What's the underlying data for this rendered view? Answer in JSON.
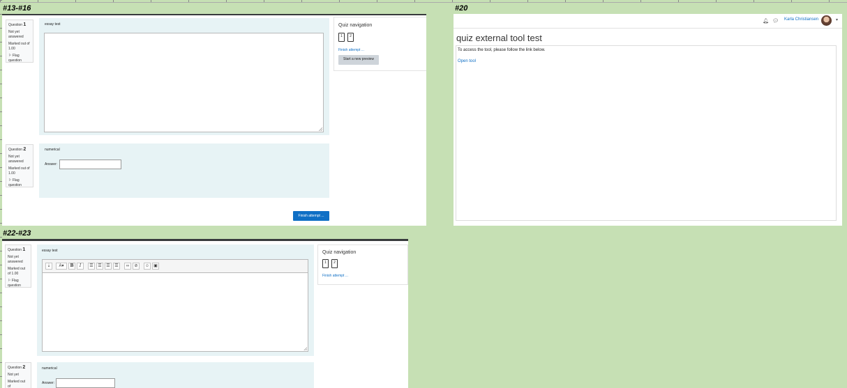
{
  "labels": {
    "p1": "#13-#16",
    "p2": "#20",
    "p3": "#22-#23"
  },
  "panel1": {
    "q1": {
      "label": "Question",
      "number": "1",
      "status": "Not yet answered",
      "mark": "Marked out of 1.00",
      "flag": "Flag question",
      "text": "essay test"
    },
    "q2": {
      "label": "Question",
      "number": "2",
      "status": "Not yet answered",
      "mark": "Marked out of 1.00",
      "flag": "Flag question",
      "text": "numerical",
      "answer_label": "Answer:"
    },
    "nav": {
      "title": "Quiz navigation",
      "buttons": [
        "1",
        "2"
      ],
      "finish_link": "Finish attempt ...",
      "preview_button": "Start a new preview"
    },
    "finish_button": "Finish attempt ..."
  },
  "panel2": {
    "user": "Karla Christiansen",
    "title": "quiz external tool test",
    "description": "To access the tool, please follow the link below.",
    "link": "Open tool",
    "colors": {
      "link": "#0f6fc5"
    }
  },
  "panel3": {
    "q1": {
      "label": "Question",
      "number": "1",
      "status": "Not yet answered",
      "mark": "Marked out of 1.00",
      "flag": "Flag question",
      "text": "essay test"
    },
    "q2": {
      "label": "Question",
      "number": "2",
      "status": "Not yet",
      "mark": "Marked out of",
      "text": "numerical",
      "answer_label": "Answer:"
    },
    "nav": {
      "title": "Quiz navigation",
      "buttons": [
        "1",
        "2"
      ],
      "finish_link": "Finish attempt ..."
    },
    "toolbar_icons": [
      "expand-toolbar-icon",
      "font-size-icon",
      "bold-icon",
      "italic-icon",
      "bullet-list-icon",
      "numbered-list-icon",
      "outdent-icon",
      "indent-icon",
      "link-icon",
      "unlink-icon",
      "emoji-icon",
      "image-icon"
    ]
  }
}
